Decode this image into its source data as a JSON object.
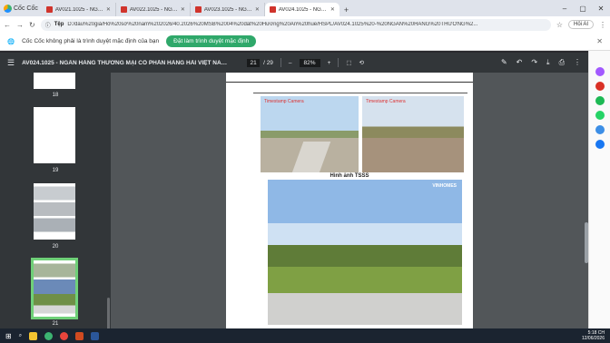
{
  "browser": {
    "brand": "Cốc Cốc",
    "tabs": [
      {
        "label": "AV021.1025 - NGÂN HÀNG THƯ"
      },
      {
        "label": "AV022.1025 - NGÂN HÀNG THƯ"
      },
      {
        "label": "AV023.1025 - NGÂN HÀNG THƯ"
      },
      {
        "label": "AV024.1025 - NGÂN HÀNG THƯ"
      }
    ],
    "new_tab": "+",
    "site_label": "Tệp",
    "url": "D:/đấu%20giá/Hồ%20sơ%20năm%202026/40.2026%20MSB%2004%20đất%20Hương%20An%20huế/HSPL/AV024.1025%20-%20NGÂN%20HÀNG%20THƯƠNG%2...",
    "hai_ai": "Hỏi AI"
  },
  "notice": {
    "text": "Cốc Cốc không phải là trình duyệt mặc định của bạn",
    "button": "Đặt làm trình duyệt mặc định"
  },
  "pdf": {
    "title": "AV024.1025 - NGÂN HÀNG THƯƠNG MẠI CỔ PHẦN HÀNG HẢI VIỆT NAM -...",
    "page_current": "21",
    "page_total": "/ 29",
    "zoom": "82%",
    "thumbs": [
      {
        "num": "18"
      },
      {
        "num": "19"
      },
      {
        "num": "20"
      },
      {
        "num": "21"
      }
    ],
    "caption": "Hình ảnh TSSS",
    "photo_stamp": "Timestamp Camera",
    "watermark": "VINHOMES"
  },
  "taskbar": {
    "time": "5:18 CH",
    "date": "12/06/2026"
  }
}
